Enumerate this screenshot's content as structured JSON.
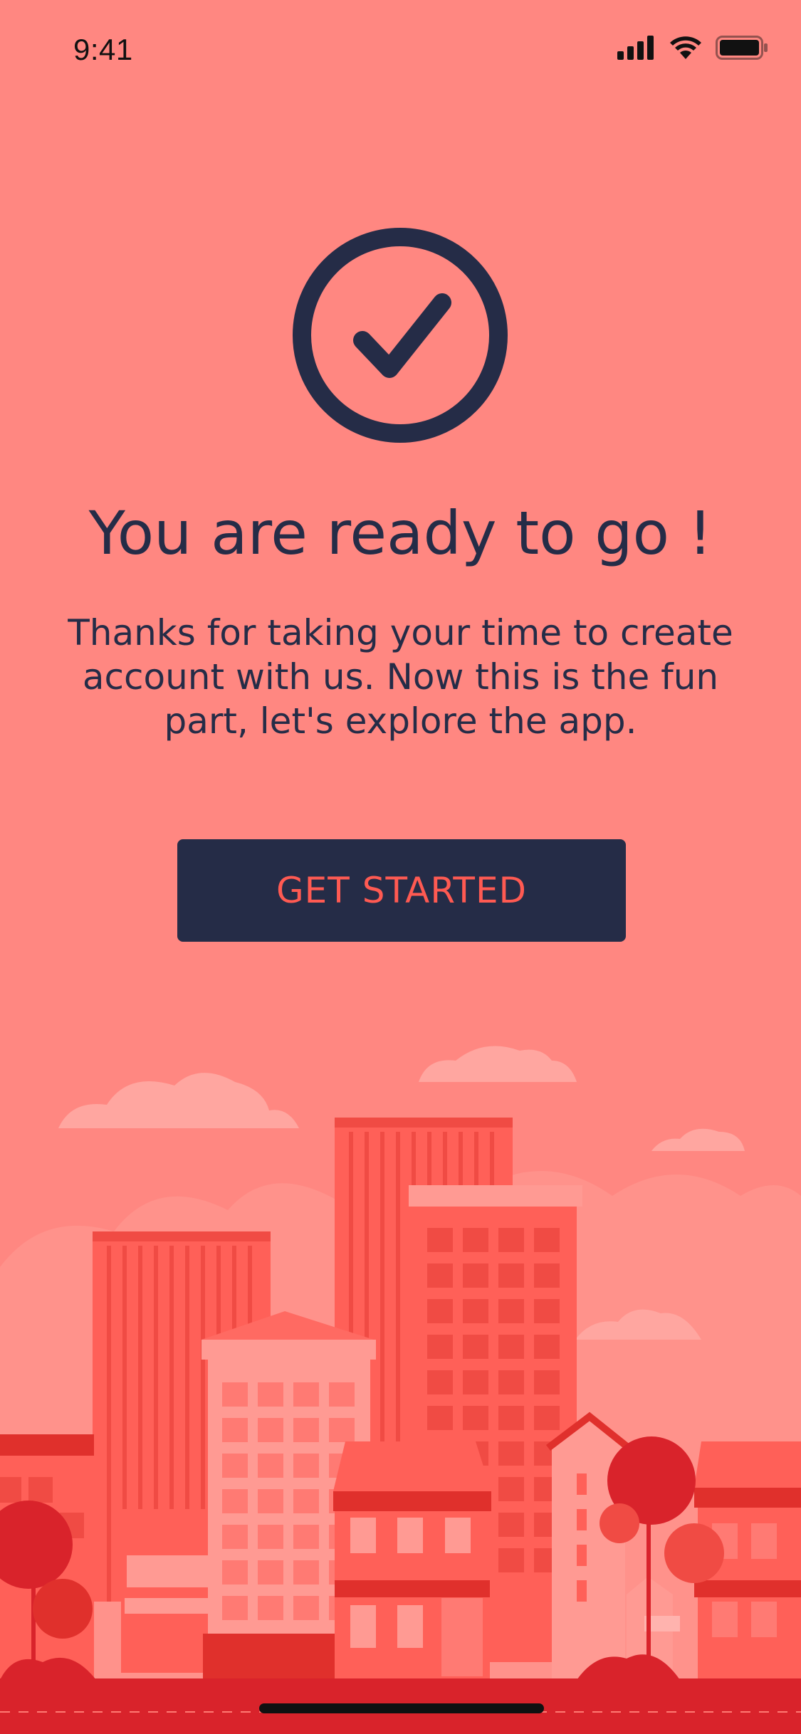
{
  "status": {
    "time": "9:41",
    "icons": [
      "signal-icon",
      "wifi-icon",
      "battery-icon"
    ]
  },
  "hero": {
    "icon": "check-circle-icon"
  },
  "title": "You are ready to go !",
  "subtitle": "Thanks for taking your time to create account with us. Now this is the fun part, let's explore the app.",
  "cta": {
    "label": "GET STARTED"
  },
  "colors": {
    "background": "#FF8781",
    "primary_dark": "#252C47",
    "accent": "#FF5A52"
  }
}
